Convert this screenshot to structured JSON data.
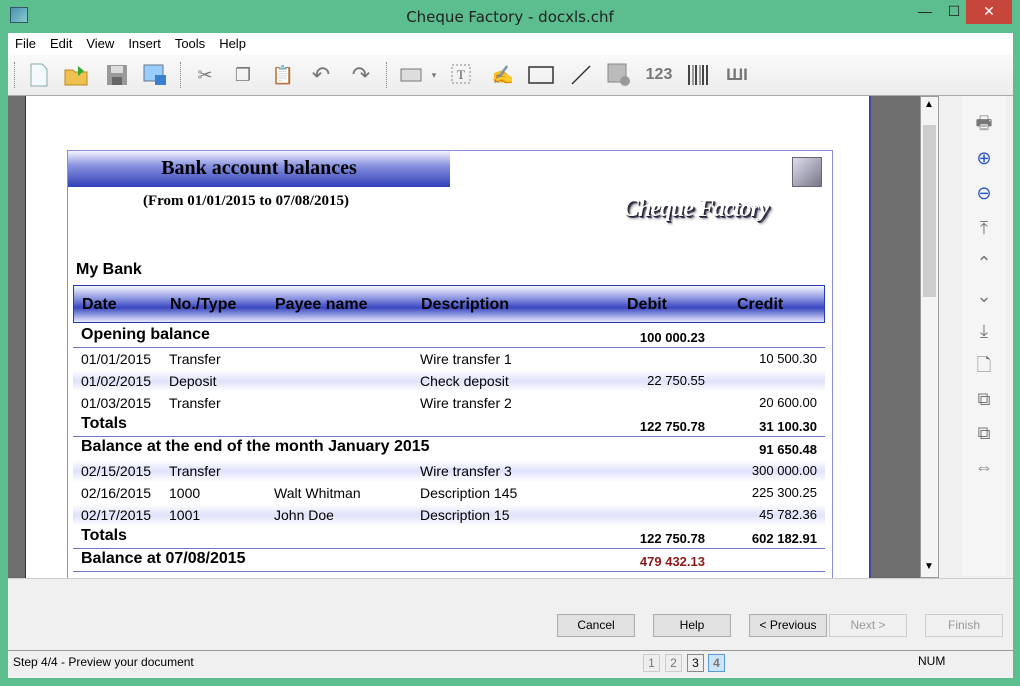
{
  "window": {
    "title": "Cheque Factory - docxls.chf",
    "minimize": "—",
    "maximize": "☐",
    "close": "✕"
  },
  "menu": [
    "File",
    "Edit",
    "View",
    "Insert",
    "Tools",
    "Help"
  ],
  "toolbar": [
    "new-document",
    "open-folder",
    "save",
    "save-image",
    "cut",
    "copy",
    "paste",
    "undo",
    "redo",
    "insert-cheque",
    "insert-text",
    "insert-signature",
    "rectangle",
    "line",
    "insert-image",
    "insert-number",
    "barcode",
    "micr"
  ],
  "sidebar": [
    "print",
    "zoom-in",
    "zoom-out",
    "first-page",
    "previous-page",
    "next-page",
    "last-page",
    "single-page",
    "two-pages",
    "multiple-pages",
    "page-width"
  ],
  "report": {
    "title": "Bank account balances",
    "subtitle": "(From 01/01/2015 to 07/08/2015)",
    "logo": "Cheque Factory",
    "bank": "My Bank",
    "columns": [
      "Date",
      "No./Type",
      "Payee name",
      "Description",
      "Debit",
      "Credit"
    ],
    "opening": {
      "label": "Opening balance",
      "debit": "100 000.23"
    },
    "rows1": [
      {
        "date": "01/01/2015",
        "type": "Transfer",
        "payee": "",
        "desc": "Wire transfer 1",
        "debit": "",
        "credit": "10 500.30"
      },
      {
        "date": "01/02/2015",
        "type": "Deposit",
        "payee": "",
        "desc": "Check deposit",
        "debit": "22 750.55",
        "credit": ""
      },
      {
        "date": "01/03/2015",
        "type": "Transfer",
        "payee": "",
        "desc": "Wire transfer 2",
        "debit": "",
        "credit": "20 600.00"
      }
    ],
    "totals1": {
      "label": "Totals",
      "debit": "122 750.78",
      "credit": "31 100.30"
    },
    "month": {
      "label": "Balance at the end of the month January 2015",
      "credit": "91 650.48"
    },
    "rows2": [
      {
        "date": "02/15/2015",
        "type": "Transfer",
        "payee": "",
        "desc": "Wire transfer 3",
        "debit": "",
        "credit": "300 000.00"
      },
      {
        "date": "02/16/2015",
        "type": "1000",
        "payee": "Walt Whitman",
        "desc": "Description 145",
        "debit": "",
        "credit": "225 300.25"
      },
      {
        "date": "02/17/2015",
        "type": "1001",
        "payee": "John Doe",
        "desc": "Description 15",
        "debit": "",
        "credit": "45 782.36"
      }
    ],
    "totals2": {
      "label": "Totals",
      "debit": "122 750.78",
      "credit": "602 182.91"
    },
    "final": {
      "label": "Balance at 07/08/2015",
      "debit": "479 432.13",
      "color": "#8b1a1a"
    }
  },
  "buttons": {
    "cancel": "Cancel",
    "help": "Help",
    "previous": "< Previous",
    "next": "Next >",
    "finish": "Finish"
  },
  "status": {
    "text": "Step 4/4 - Preview your document",
    "steps": [
      "1",
      "2",
      "3",
      "4"
    ],
    "current_step": 4,
    "num": "NUM"
  }
}
